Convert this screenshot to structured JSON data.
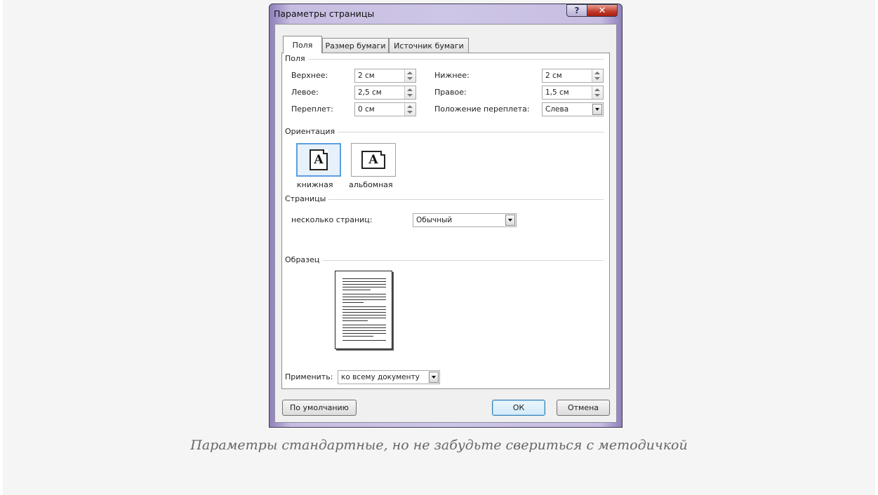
{
  "dialog": {
    "title": "Параметры страницы",
    "help_glyph": "?",
    "close_glyph": "✕"
  },
  "tabs": [
    {
      "label": "Поля",
      "active": true
    },
    {
      "label": "Размер бумаги",
      "active": false
    },
    {
      "label": "Источник бумаги",
      "active": false
    }
  ],
  "margins": {
    "group_label": "Поля",
    "top_label": "Верхнее:",
    "top_value": "2 см",
    "bottom_label": "Нижнее:",
    "bottom_value": "2 см",
    "left_label": "Левое:",
    "left_value": "2,5 см",
    "right_label": "Правое:",
    "right_value": "1,5 см",
    "gutter_label": "Переплет:",
    "gutter_value": "0 см",
    "gutter_pos_label": "Положение переплета:",
    "gutter_pos_value": "Слева"
  },
  "orientation": {
    "group_label": "Ориентация",
    "icon_letter": "A",
    "portrait_label": "книжная",
    "landscape_label": "альбомная",
    "selected": "portrait"
  },
  "pages": {
    "group_label": "Страницы",
    "multiple_label": "несколько страниц:",
    "multiple_value": "Обычный"
  },
  "preview": {
    "group_label": "Образец"
  },
  "apply": {
    "label": "Применить:",
    "value": "ко всему документу"
  },
  "buttons": {
    "default_label": "По умолчанию",
    "ok_label": "ОК",
    "cancel_label": "Отмена"
  },
  "caption": "Параметры стандартные, но не забудьте свериться с методичкой",
  "colors": {
    "title_bar": "#cec6e6",
    "close_button": "#c0392b",
    "selection_border": "#5a9fe0"
  }
}
